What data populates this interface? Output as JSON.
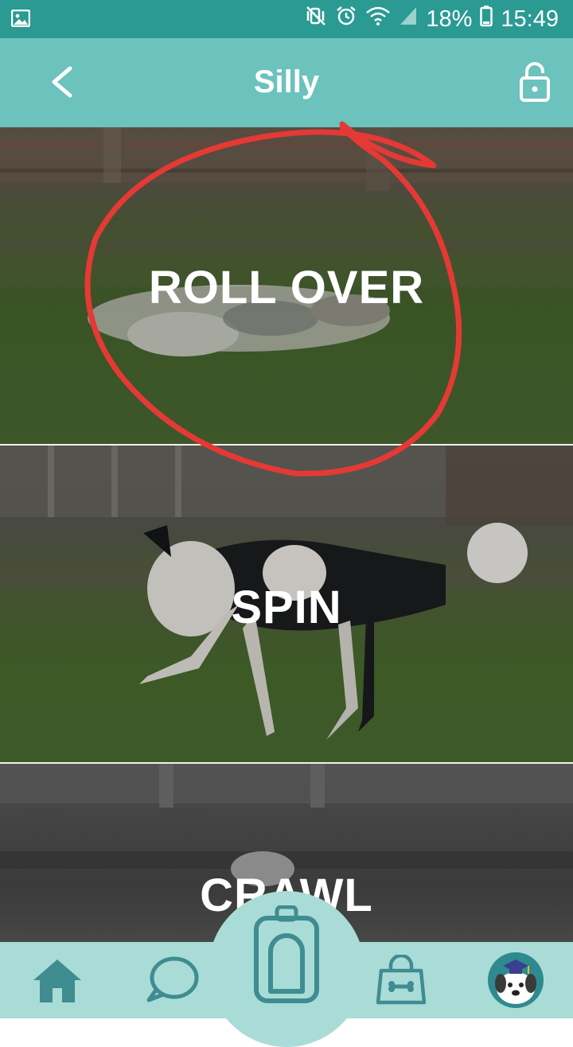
{
  "status_bar": {
    "battery": "18%",
    "time": "15:49",
    "icons": [
      "gallery-icon",
      "mute-vibrate-icon",
      "alarm-icon",
      "wifi-icon",
      "signal-icon",
      "battery-icon"
    ]
  },
  "app_bar": {
    "title": "Silly",
    "back_icon": "chevron-left-icon",
    "lock_icon": "unlock-icon"
  },
  "tricks": [
    {
      "label": "ROLL OVER"
    },
    {
      "label": "SPIN"
    },
    {
      "label": "CRAWL"
    }
  ],
  "annotation": {
    "type": "circle",
    "color": "#e53935"
  },
  "bottom_nav": {
    "items": [
      "home-icon",
      "chat-icon",
      "clicker-icon",
      "shop-bag-icon",
      "profile-avatar-icon"
    ]
  },
  "colors": {
    "status_bar": "#2a9a93",
    "app_bar": "#6cc2bd",
    "bottom_nav": "#a9dcd7",
    "nav_icon": "#3f8c91"
  }
}
